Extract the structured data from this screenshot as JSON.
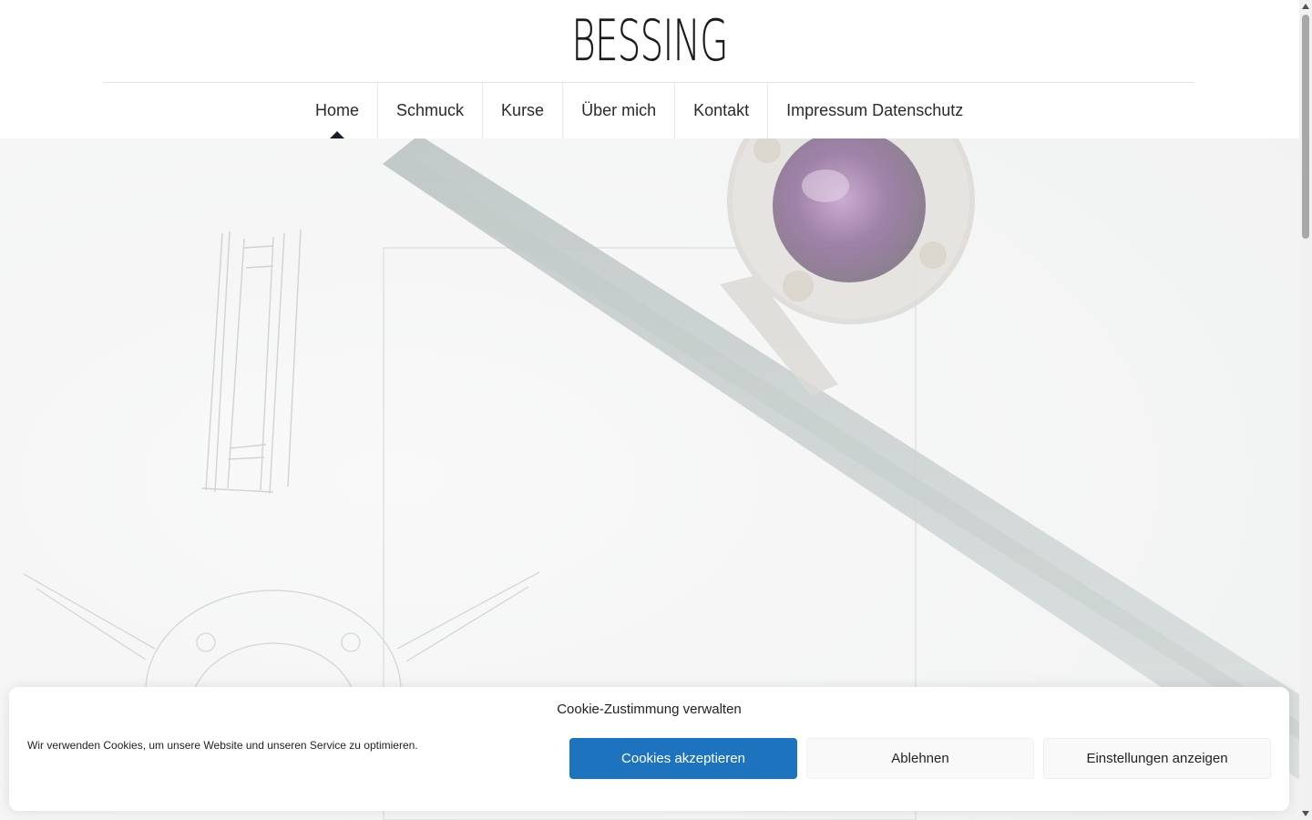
{
  "site": {
    "logo_text": "BESSING"
  },
  "nav": {
    "items": [
      {
        "label": "Home",
        "active": true
      },
      {
        "label": "Schmuck",
        "active": false
      },
      {
        "label": "Kurse",
        "active": false
      },
      {
        "label": "Über mich",
        "active": false
      },
      {
        "label": "Kontakt",
        "active": false
      },
      {
        "label": "Impressum Datenschutz",
        "active": false
      }
    ]
  },
  "cookie_banner": {
    "title": "Cookie-Zustimmung verwalten",
    "message": "Wir verwenden Cookies, um unsere Website und unseren Service zu optimieren.",
    "accept_label": "Cookies akzeptieren",
    "deny_label": "Ablehnen",
    "settings_label": "Einstellungen anzeigen"
  },
  "colors": {
    "accent": "#1e73be",
    "nav_text": "#2a2a2a",
    "hero_bg": "#f3f4f3"
  }
}
